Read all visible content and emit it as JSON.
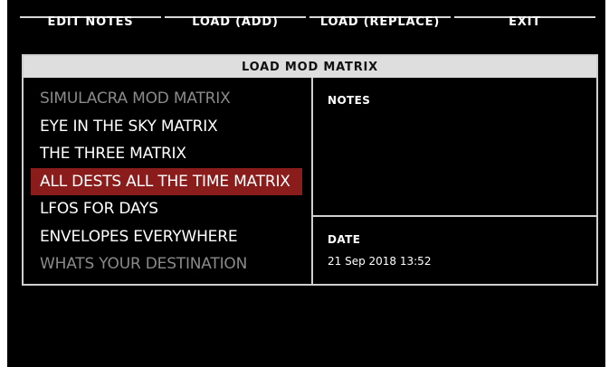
{
  "menu": {
    "items": [
      {
        "label": "EDIT NOTES"
      },
      {
        "label": "LOAD (ADD)"
      },
      {
        "label": "LOAD (REPLACE)"
      },
      {
        "label": "EXIT"
      }
    ]
  },
  "dialog": {
    "title": "LOAD MOD MATRIX",
    "presets": [
      {
        "label": "SIMULACRA MOD MATRIX",
        "state": "faded"
      },
      {
        "label": "EYE IN THE SKY MATRIX",
        "state": "normal"
      },
      {
        "label": "THE THREE MATRIX",
        "state": "normal"
      },
      {
        "label": "ALL DESTS ALL THE TIME MATRIX",
        "state": "selected"
      },
      {
        "label": "LFOS FOR DAYS",
        "state": "normal"
      },
      {
        "label": "ENVELOPES EVERYWHERE",
        "state": "normal"
      },
      {
        "label": "WHATS YOUR DESTINATION",
        "state": "faded"
      }
    ],
    "notes_label": "NOTES",
    "date_label": "DATE",
    "date_value": "21 Sep 2018 13:52"
  },
  "colors": {
    "selected": "#8b1c1c",
    "background": "#000000",
    "frame": "#d0d0d0"
  }
}
